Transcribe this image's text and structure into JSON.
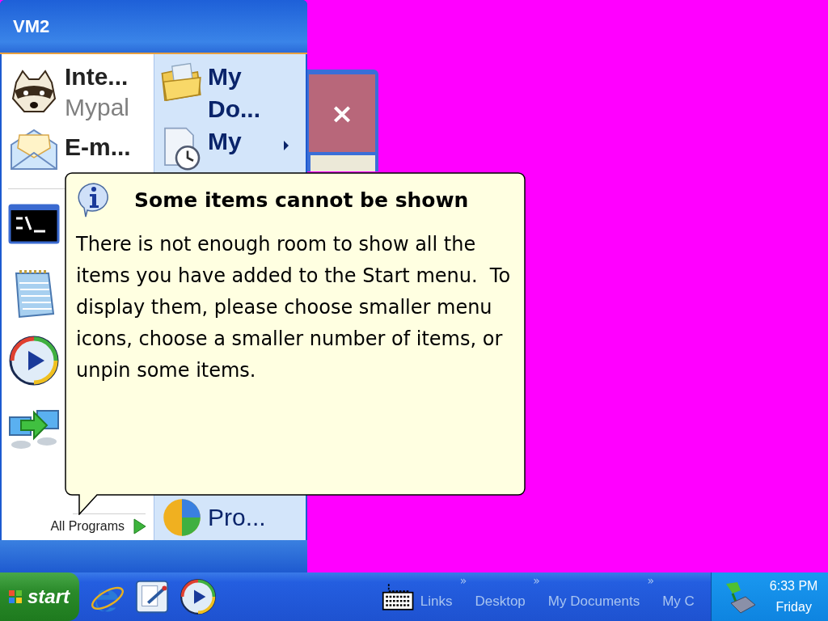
{
  "background_window": {
    "close_glyph": "×"
  },
  "start_menu": {
    "user_name": "VM2",
    "pinned": [
      {
        "title": "Inte...",
        "subtitle": "Mypal"
      },
      {
        "title": "E-m..."
      }
    ],
    "all_programs": "All Programs",
    "places": [
      {
        "lines": [
          "My",
          "Do..."
        ],
        "submenu": false
      },
      {
        "lines": [
          "My"
        ],
        "submenu": true
      },
      {
        "lines": [
          "Pro..."
        ],
        "submenu": false
      }
    ]
  },
  "balloon": {
    "title": "Some items cannot be shown",
    "message": "There is not enough room to show all the items you have added to the Start menu.  To display them, please choose smaller menu icons, choose a smaller number of items, or unpin some items."
  },
  "taskbar": {
    "start_label": "start",
    "toolbars": [
      {
        "label": "Links",
        "chevron": "»"
      },
      {
        "label": "Desktop",
        "chevron": "»"
      },
      {
        "label": "My Documents",
        "chevron": "»"
      },
      {
        "label": "My C"
      }
    ],
    "clock": {
      "time": "6:33 PM",
      "day": "Friday"
    }
  }
}
